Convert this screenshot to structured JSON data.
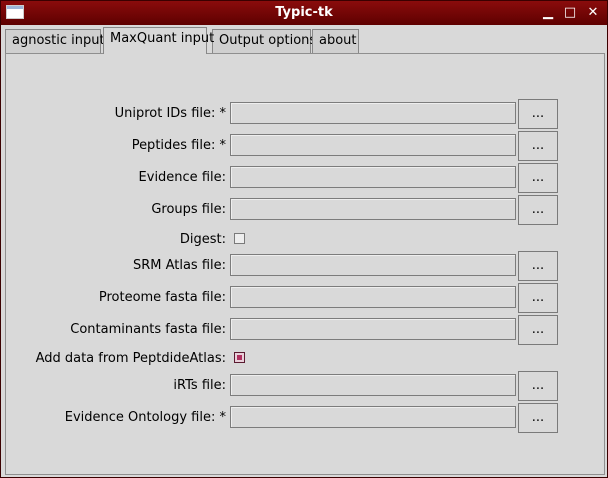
{
  "window": {
    "title": "Typic-tk",
    "minimize": "▁",
    "maximize": "□",
    "close": "✕"
  },
  "tabs": [
    {
      "label": "agnostic input",
      "active": false
    },
    {
      "label": "MaxQuant input",
      "active": true
    },
    {
      "label": "Output options",
      "active": false
    },
    {
      "label": "about",
      "active": false
    }
  ],
  "form": {
    "browse_label": "...",
    "rows": [
      {
        "label": "Uniprot IDs file: *",
        "value": ""
      },
      {
        "label": "Peptides file: *",
        "value": ""
      },
      {
        "label": "Evidence file:",
        "value": ""
      },
      {
        "label": "Groups file:",
        "value": ""
      },
      {
        "label": "Digest:",
        "checked": false
      },
      {
        "label": "SRM Atlas file:",
        "value": ""
      },
      {
        "label": "Proteome fasta file:",
        "value": ""
      },
      {
        "label": "Contaminants fasta file:",
        "value": ""
      },
      {
        "label": "Add data from PeptdideAtlas:",
        "checked": true
      },
      {
        "label": "iRTs file:",
        "value": ""
      },
      {
        "label": "Evidence Ontology file: *",
        "value": ""
      }
    ]
  },
  "colors": {
    "titlebar": "#7a0606",
    "checkbox_checked": "#b03060"
  }
}
